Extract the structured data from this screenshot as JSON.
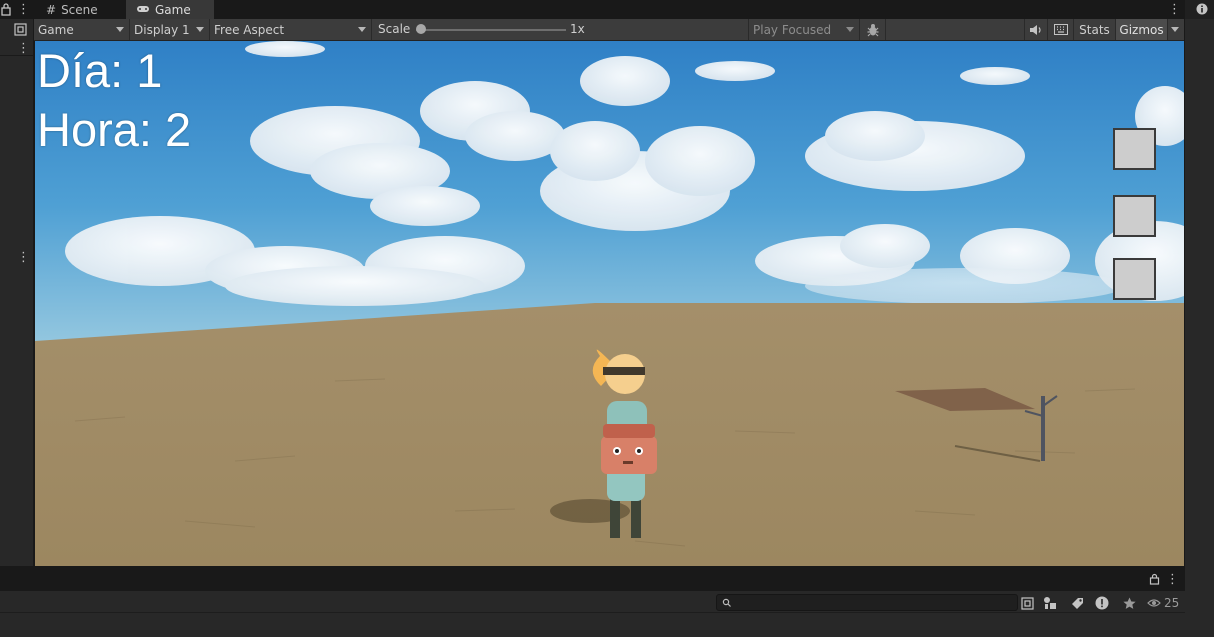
{
  "tabs": [
    {
      "label": "Scene",
      "icon": "hash-grid-icon"
    },
    {
      "label": "Game",
      "icon": "gamepad-icon"
    }
  ],
  "toolbar": {
    "target": "Game",
    "display": "Display 1",
    "aspect": "Free Aspect",
    "scale_label": "Scale",
    "scale_value": "1x",
    "scale_fraction": 0.0,
    "play_mode": "Play Focused",
    "stats": "Stats",
    "gizmos": "Gizmos"
  },
  "hud": {
    "day": "Día: 1",
    "hour": "Hora: 2"
  },
  "inventory_slots": 3,
  "console": {
    "search_placeholder": "",
    "warning_count": "25"
  },
  "colors": {
    "editor_bg": "#191919",
    "toolbar_bg": "#3c3c3c",
    "panel_bg": "#282828",
    "sky_top": "#2f80c6",
    "sky_horizon": "#8fc2de",
    "ground": "#a58f66",
    "slot_fill": "#cdcdcd"
  }
}
